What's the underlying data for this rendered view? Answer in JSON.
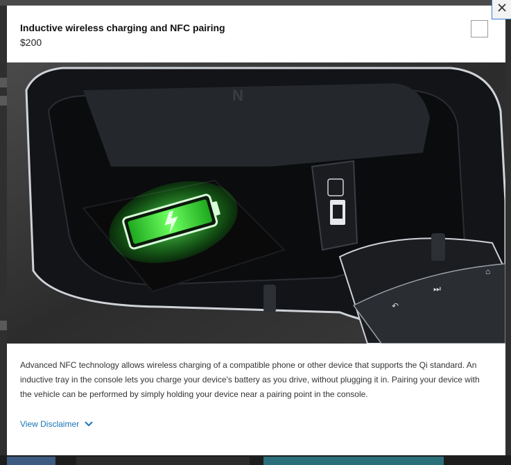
{
  "modal": {
    "title": "Inductive wireless charging and NFC pairing",
    "price": "$200",
    "description": "Advanced NFC technology allows wireless charging of a compatible phone or other device that supports the Qi standard. An inductive tray in the console lets you charge your device's battery as you drive, without plugging it in. Pairing your device with the vehicle can be performed by simply holding your device near a pairing point in the console.",
    "disclaimer_label": "View Disclaimer",
    "close_icon": "close-icon",
    "disclaimer_icon": "chevron-down-icon",
    "image_subject": "center console with wireless charging tray and USB port"
  },
  "colors": {
    "link": "#1a73b8",
    "accent_green": "#3cff3c",
    "overlay": "#3b3b3b"
  }
}
